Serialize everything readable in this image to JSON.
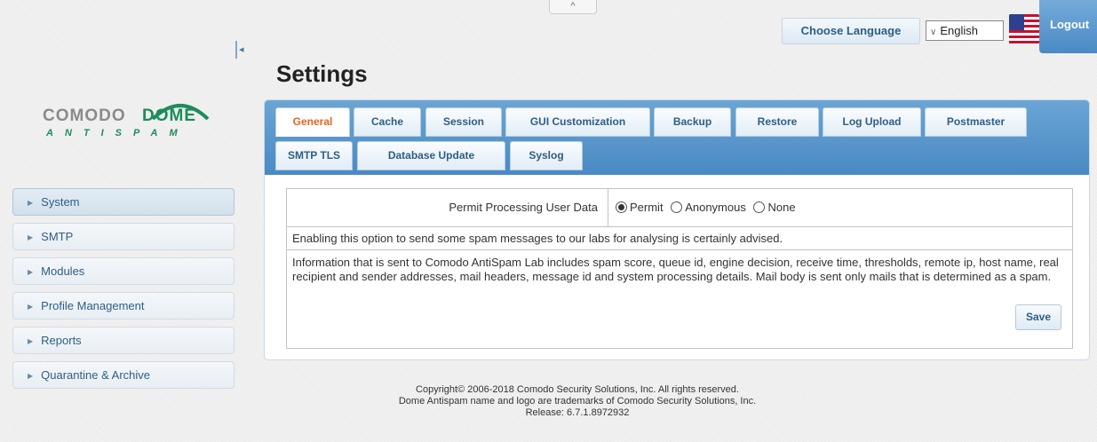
{
  "header": {
    "collapse_handle_glyph": "^",
    "choose_language_label": "Choose Language",
    "language_select_value": "English",
    "logout_label": "Logout",
    "sidebar_toggle_glyph": "◂"
  },
  "logo": {
    "brand_word_1": "COMODO",
    "brand_word_2": "DOME",
    "tagline": "ANTISPAM",
    "brand_green": "#1d8c5a"
  },
  "page": {
    "title": "Settings"
  },
  "sidebar": {
    "items": [
      {
        "label": "System"
      },
      {
        "label": "SMTP"
      },
      {
        "label": "Modules"
      },
      {
        "label": "Profile Management"
      },
      {
        "label": "Reports"
      },
      {
        "label": "Quarantine & Archive"
      }
    ]
  },
  "tabs": {
    "row1": [
      "General",
      "Cache",
      "Session",
      "GUI Customization",
      "Backup",
      "Restore",
      "Log Upload",
      "Postmaster"
    ],
    "row2": [
      "SMTP TLS",
      "Database Update",
      "Syslog"
    ],
    "active": "General"
  },
  "settings": {
    "permit_label": "Permit Processing User Data",
    "options": [
      "Permit",
      "Anonymous",
      "None"
    ],
    "selected_option": "Permit",
    "note": "Enabling this option to send some spam messages to our labs for analysing is certainly advised.",
    "info": "Information that is sent to Comodo AntiSpam Lab includes spam score, queue id, engine decision, receive time, thresholds, remote ip, host name, real recipient and sender addresses, mail headers, message id and system processing details. Mail body is sent only mails that is determined as a spam.",
    "save_label": "Save"
  },
  "footer": {
    "line1": "Copyright© 2006-2018 Comodo Security Solutions, Inc. All rights reserved.",
    "line2": "Dome Antispam name and logo are trademarks of Comodo Security Solutions, Inc.",
    "line3": "Release: 6.7.1.8972932"
  },
  "colors": {
    "accent_blue": "#4a89c4",
    "active_tab_text": "#e5631e",
    "link_blue": "#2d5e86"
  }
}
